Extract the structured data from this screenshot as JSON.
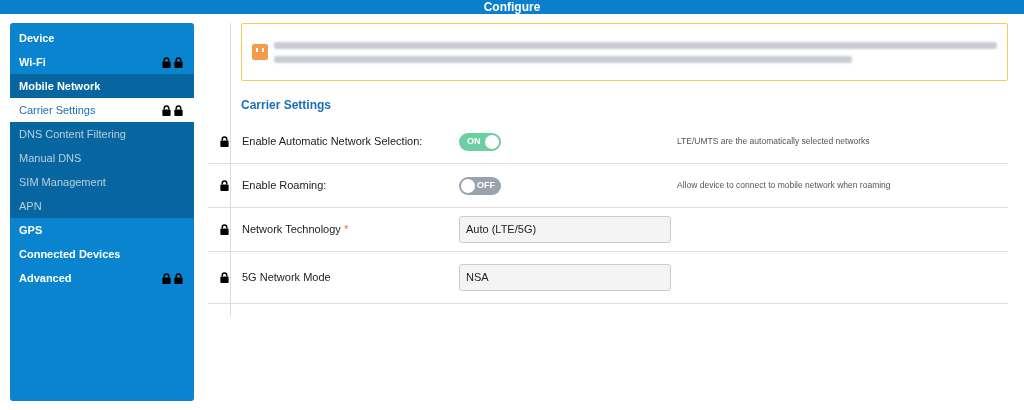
{
  "header": {
    "title": "Configure"
  },
  "sidebar": {
    "items": [
      {
        "label": "Device",
        "kind": "section",
        "selected": false,
        "locked": false
      },
      {
        "label": "Wi-Fi",
        "kind": "section",
        "selected": false,
        "locked": true
      },
      {
        "label": "Mobile Network",
        "kind": "group",
        "selected": false,
        "locked": false,
        "children": [
          {
            "label": "Carrier Settings",
            "kind": "sub",
            "selected": true,
            "locked": true
          },
          {
            "label": "DNS Content Filtering",
            "kind": "sub",
            "selected": false,
            "locked": false
          },
          {
            "label": "Manual DNS",
            "kind": "sub",
            "selected": false,
            "locked": false
          },
          {
            "label": "SIM Management",
            "kind": "sub",
            "selected": false,
            "locked": false
          },
          {
            "label": "APN",
            "kind": "sub",
            "selected": false,
            "locked": false
          }
        ]
      },
      {
        "label": "GPS",
        "kind": "section",
        "selected": false,
        "locked": false
      },
      {
        "label": "Connected Devices",
        "kind": "section",
        "selected": false,
        "locked": false
      },
      {
        "label": "Advanced",
        "kind": "section",
        "selected": false,
        "locked": true
      }
    ]
  },
  "section_title": "Carrier Settings",
  "settings": [
    {
      "label": "Enable Automatic Network Selection:",
      "kind": "toggle",
      "on": true,
      "toggle_text": "ON",
      "hint": "LTE/UMTS are the automatically selected networks"
    },
    {
      "label": "Enable Roaming:",
      "kind": "toggle",
      "on": false,
      "toggle_text": "OFF",
      "hint": "Allow device to connect to mobile network when roaming"
    },
    {
      "label": "Network Technology",
      "kind": "select",
      "value": "Auto (LTE/5G)",
      "required_mark": "*"
    },
    {
      "label": "5G Network Mode",
      "kind": "select",
      "value": "NSA"
    }
  ]
}
